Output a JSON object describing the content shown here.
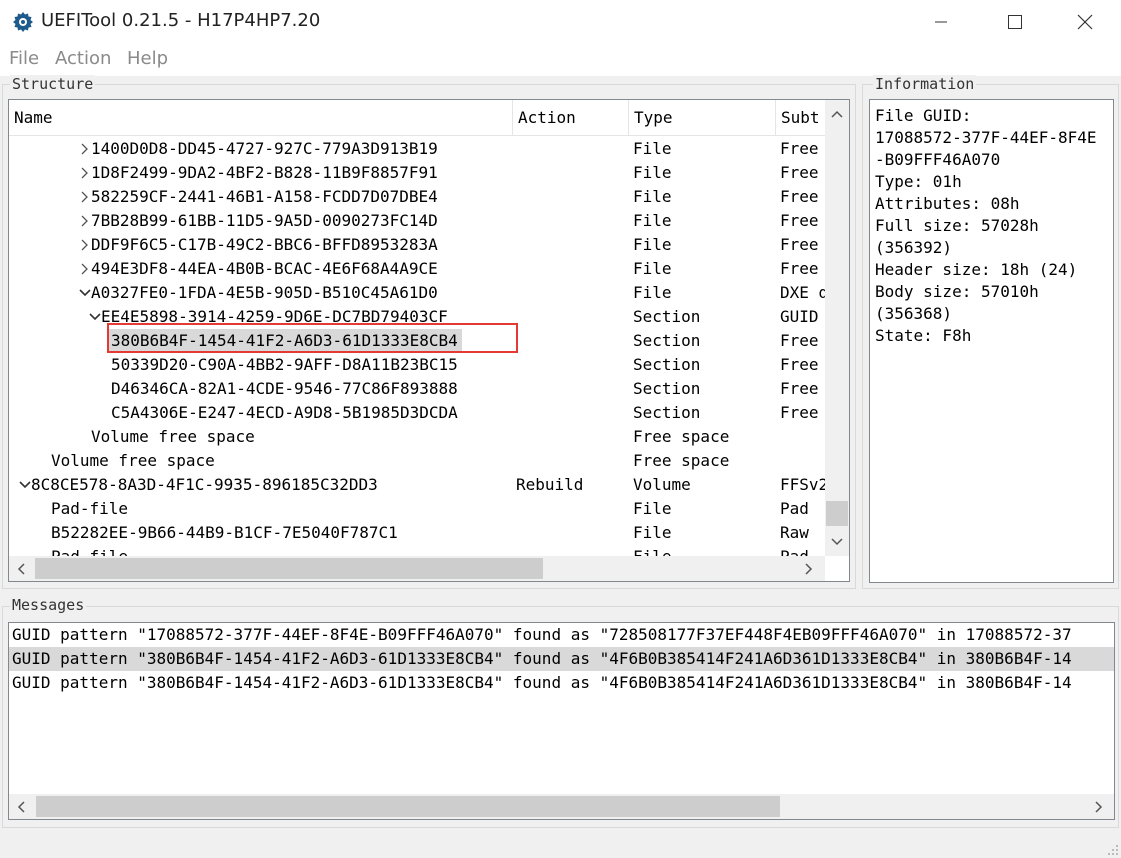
{
  "window": {
    "title": "UEFITool 0.21.5 - H17P4HP7.20",
    "icon": "gear-icon",
    "controls": [
      "minimize-icon",
      "maximize-icon",
      "close-icon"
    ]
  },
  "menu": {
    "items": [
      {
        "label": "File"
      },
      {
        "label": "Action"
      },
      {
        "label": "Help"
      }
    ]
  },
  "structure": {
    "group_label": "Structure",
    "columns": [
      "Name",
      "Action",
      "Type",
      "Subt"
    ],
    "rows": [
      {
        "name": "1400D0D8-DD45-4727-927C-779A3D913B19",
        "action": "",
        "type": "File",
        "subtype": "Free",
        "expander": "collapsed",
        "indent": 3,
        "selected": false
      },
      {
        "name": "1D8F2499-9DA2-4BF2-B828-11B9F8857F91",
        "action": "",
        "type": "File",
        "subtype": "Free",
        "expander": "collapsed",
        "indent": 3,
        "selected": false
      },
      {
        "name": "582259CF-2441-46B1-A158-FCDD7D07DBE4",
        "action": "",
        "type": "File",
        "subtype": "Free",
        "expander": "collapsed",
        "indent": 3,
        "selected": false
      },
      {
        "name": "7BB28B99-61BB-11D5-9A5D-0090273FC14D",
        "action": "",
        "type": "File",
        "subtype": "Free",
        "expander": "collapsed",
        "indent": 3,
        "selected": false
      },
      {
        "name": "DDF9F6C5-C17B-49C2-BBC6-BFFD8953283A",
        "action": "",
        "type": "File",
        "subtype": "Free",
        "expander": "collapsed",
        "indent": 3,
        "selected": false
      },
      {
        "name": "494E3DF8-44EA-4B0B-BCAC-4E6F68A4A9CE",
        "action": "",
        "type": "File",
        "subtype": "Free",
        "expander": "collapsed",
        "indent": 3,
        "selected": false
      },
      {
        "name": "A0327FE0-1FDA-4E5B-905D-B510C45A61D0",
        "action": "",
        "type": "File",
        "subtype": "DXE d",
        "expander": "expanded",
        "indent": 3,
        "selected": false
      },
      {
        "name": "EE4E5898-3914-4259-9D6E-DC7BD79403CF",
        "action": "",
        "type": "Section",
        "subtype": "GUID",
        "expander": "expanded",
        "indent": 4,
        "selected": false
      },
      {
        "name": "380B6B4F-1454-41F2-A6D3-61D1333E8CB4",
        "action": "",
        "type": "Section",
        "subtype": "Free",
        "expander": "none",
        "indent": 5,
        "selected": true
      },
      {
        "name": "50339D20-C90A-4BB2-9AFF-D8A11B23BC15",
        "action": "",
        "type": "Section",
        "subtype": "Free",
        "expander": "none",
        "indent": 5,
        "selected": false
      },
      {
        "name": "D46346CA-82A1-4CDE-9546-77C86F893888",
        "action": "",
        "type": "Section",
        "subtype": "Free",
        "expander": "none",
        "indent": 5,
        "selected": false
      },
      {
        "name": "C5A4306E-E247-4ECD-A9D8-5B1985D3DCDA",
        "action": "",
        "type": "Section",
        "subtype": "Free",
        "expander": "none",
        "indent": 5,
        "selected": false
      },
      {
        "name": "Volume free space",
        "action": "",
        "type": "Free space",
        "subtype": "",
        "expander": "none",
        "indent": 3,
        "selected": false
      },
      {
        "name": "Volume free space",
        "action": "",
        "type": "Free space",
        "subtype": "",
        "expander": "none",
        "indent": 1,
        "selected": false
      },
      {
        "name": "8C8CE578-8A3D-4F1C-9935-896185C32DD3",
        "action": "Rebuild",
        "type": "Volume",
        "subtype": "FFSv2",
        "expander": "expanded",
        "indent": 0,
        "selected": false
      },
      {
        "name": "Pad-file",
        "action": "",
        "type": "File",
        "subtype": "Pad",
        "expander": "none",
        "indent": 1,
        "selected": false
      },
      {
        "name": "B52282EE-9B66-44B9-B1CF-7E5040F787C1",
        "action": "",
        "type": "File",
        "subtype": "Raw",
        "expander": "none",
        "indent": 1,
        "selected": false
      },
      {
        "name": "Pad-file",
        "action": "",
        "type": "File",
        "subtype": "Pad",
        "expander": "none",
        "indent": 1,
        "selected": false
      }
    ]
  },
  "information": {
    "group_label": "Information",
    "lines": [
      "File GUID:",
      "17088572-377F-44EF-8F4E",
      "-B09FFF46A070",
      "Type: 01h",
      "Attributes: 08h",
      "Full size: 57028h",
      "(356392)",
      "Header size: 18h (24)",
      "Body size: 57010h",
      "(356368)",
      "State: F8h"
    ]
  },
  "messages": {
    "group_label": "Messages",
    "lines": [
      {
        "text": "GUID pattern \"17088572-377F-44EF-8F4E-B09FFF46A070\" found as \"728508177F37EF448F4EB09FFF46A070\" in 17088572-37",
        "selected": false
      },
      {
        "text": "GUID pattern \"380B6B4F-1454-41F2-A6D3-61D1333E8CB4\" found as \"4F6B0B385414F241A6D361D1333E8CB4\" in 380B6B4F-14",
        "selected": true
      },
      {
        "text": "GUID pattern \"380B6B4F-1454-41F2-A6D3-61D1333E8CB4\" found as \"4F6B0B385414F241A6D361D1333E8CB4\" in 380B6B4F-14",
        "selected": false
      }
    ]
  },
  "colors": {
    "selection_bg": "#d9d9d9",
    "highlight_border": "#e53935",
    "menu_text": "#8a8a8a"
  }
}
